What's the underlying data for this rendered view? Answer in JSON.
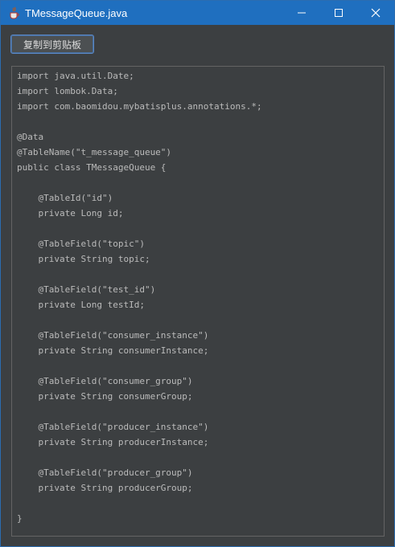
{
  "window": {
    "title": "TMessageQueue.java",
    "app_icon": "java-cup-icon",
    "controls": [
      "minimize-icon",
      "maximize-icon",
      "close-icon"
    ]
  },
  "toolbar": {
    "copy_label": "复制到剪贴板"
  },
  "code": {
    "lines": [
      "import java.util.Date;",
      "import lombok.Data;",
      "import com.baomidou.mybatisplus.annotations.*;",
      "",
      "@Data",
      "@TableName(\"t_message_queue\")",
      "public class TMessageQueue {",
      "",
      "    @TableId(\"id\")",
      "    private Long id;",
      "",
      "    @TableField(\"topic\")",
      "    private String topic;",
      "",
      "    @TableField(\"test_id\")",
      "    private Long testId;",
      "",
      "    @TableField(\"consumer_instance\")",
      "    private String consumerInstance;",
      "",
      "    @TableField(\"consumer_group\")",
      "    private String consumerGroup;",
      "",
      "    @TableField(\"producer_instance\")",
      "    private String producerInstance;",
      "",
      "    @TableField(\"producer_group\")",
      "    private String producerGroup;",
      "",
      "}"
    ]
  },
  "colors": {
    "titlebar": "#1f6fbf",
    "background": "#3c3f41",
    "text": "#bbbbbb",
    "button_border": "#5c88c5"
  }
}
